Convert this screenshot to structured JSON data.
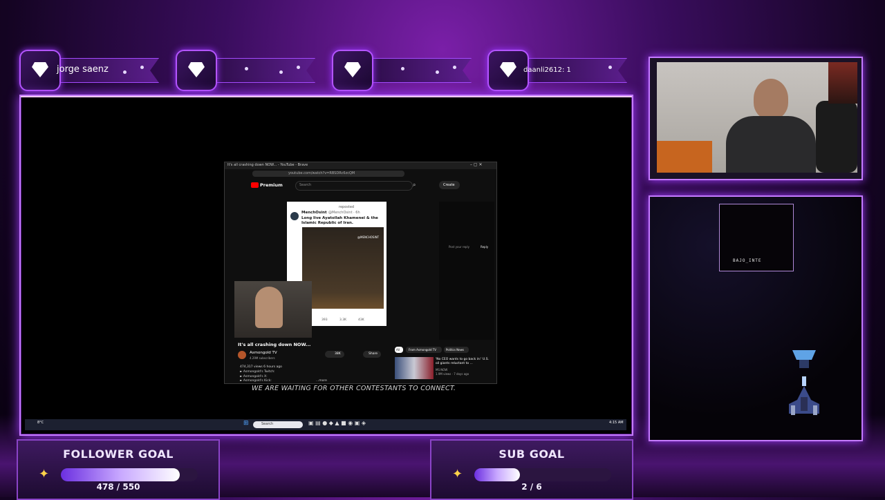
{
  "alerts": [
    {
      "name": "jorge saenz"
    },
    {
      "name": ""
    },
    {
      "name": ""
    },
    {
      "name": "daanli2612: 1"
    }
  ],
  "browser": {
    "tab_title": "It's all crashing down NOW... - YouTube - Brave",
    "url": "youtube.com/watch?v=RBSDRc6zcQM",
    "logo": "Premium",
    "search_placeholder": "Search",
    "create_label": "Create",
    "tweet": {
      "repost": "reposted",
      "author": "MenchOsint",
      "handle": "@MenchOsint · 6h",
      "text": "Long live Ayatollah Khamenei & the Islamic Republic of Iran.",
      "watermark": "@MENCHOSINT",
      "counts": [
        "393",
        "3.3K",
        "43K"
      ]
    },
    "video_title": "It's all crashing down NOW...",
    "channel": "Asmongold TV",
    "subscribers": "4.29M subscribers",
    "likes": "38K",
    "share": "Share",
    "views": "474,317 views  6 hours ago",
    "desc_lines": [
      "► Asmongold's Twitch:",
      "► Asmongold's X:",
      "► Asmongold's Kick:"
    ],
    "more": "...more",
    "chips": [
      "All",
      "From Asmongold TV",
      "Politics News"
    ],
    "rec_title": "'No CEO wants to go back in:' U.S. oil giants reluctant to ...",
    "rec_channel": "MS NOW",
    "rec_meta": "1.9M views · 7 days ago",
    "chat_post": "Post your reply",
    "chat_reply": "Reply"
  },
  "waiting_text": "WE ARE WAITING FOR OTHER CONTESTANTS TO CONNECT.",
  "taskbar": {
    "weather": "8°C",
    "search": "Search",
    "time": "4:15 AM"
  },
  "side_label": "BAJO_INTE",
  "goals": {
    "follower": {
      "title": "FOLLOWER GOAL",
      "current": 478,
      "target": 550,
      "value_text": "478 / 550"
    },
    "sub": {
      "title": "SUB GOAL",
      "current": 2,
      "target": 6,
      "value_text": "2 / 6"
    }
  },
  "colors": {
    "accent": "#c47bff",
    "glow": "#a23cff",
    "youtube_red": "#ff0000"
  }
}
